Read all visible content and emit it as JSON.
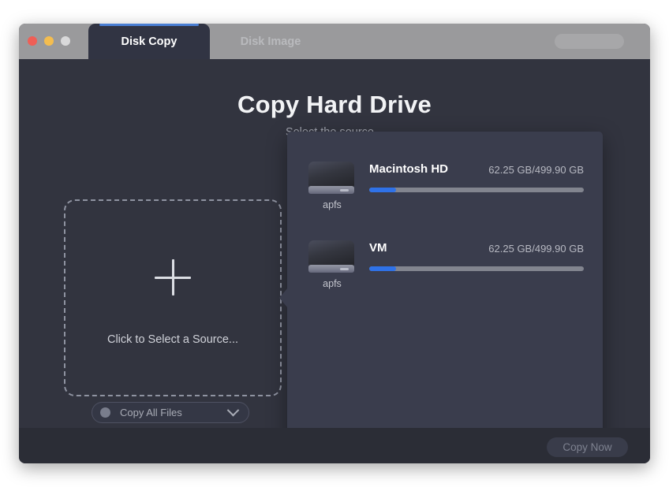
{
  "window": {
    "traffic_lights": [
      "close",
      "minimize",
      "zoom"
    ],
    "toolbar_pill": ""
  },
  "tabs": [
    {
      "label": "Disk Copy",
      "active": true
    },
    {
      "label": "Disk Image",
      "active": false
    }
  ],
  "main": {
    "headline": "Copy Hard Drive",
    "subheading": "Select the source...",
    "dropzone": {
      "icon": "plus-icon",
      "label": "Click to Select a Source..."
    },
    "mode_select": {
      "value": "Copy All Files",
      "chevron": "chevron-down-icon"
    }
  },
  "footer": {
    "primary_button": "Copy Now"
  },
  "disk_picker": {
    "disks": [
      {
        "name": "Macintosh HD",
        "filesystem": "apfs",
        "size_label": "62.25 GB/499.90 GB",
        "used_percent": 12.5
      },
      {
        "name": "VM",
        "filesystem": "apfs",
        "size_label": "62.25 GB/499.90 GB",
        "used_percent": 12.5
      }
    ]
  },
  "colors": {
    "accent_blue": "#2f72e8",
    "tab_indicator": "#4a7fd4",
    "panel_bg": "#3a3d4d",
    "window_bg": "#32343f",
    "footer_bg": "#2b2d36",
    "titlebar_bg": "#9a9a9c"
  }
}
